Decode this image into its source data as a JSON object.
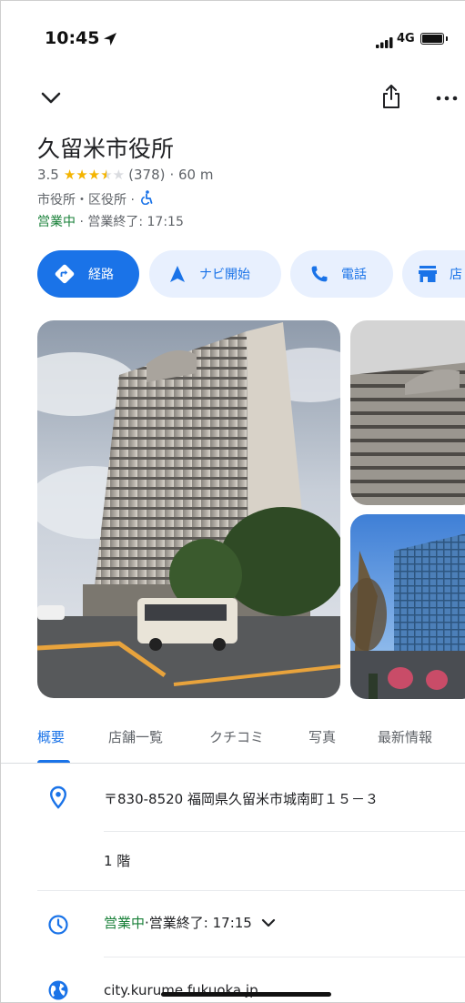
{
  "status_bar": {
    "time": "10:45",
    "network": "4G"
  },
  "place": {
    "name": "久留米市役所",
    "rating": "3.5",
    "rating_value": 3.5,
    "review_count": "(378)",
    "distance": "· 60 m",
    "category": "市役所・区役所 ·",
    "open_status": "営業中",
    "hours_sep": " · ",
    "hours_text": "営業終了: 17:15"
  },
  "actions": [
    {
      "label": "経路",
      "icon": "directions-icon"
    },
    {
      "label": "ナビ開始",
      "icon": "navigation-icon"
    },
    {
      "label": "電話",
      "icon": "phone-icon"
    },
    {
      "label": "店",
      "icon": "store-icon"
    }
  ],
  "tabs": [
    "概要",
    "店舗一覧",
    "クチコミ",
    "写真",
    "最新情報"
  ],
  "details": {
    "address": "〒830-8520 福岡県久留米市城南町１５－３",
    "floor": "1 階",
    "hours_status": "営業中",
    "hours_sep": " · ",
    "hours_text": "営業終了: 17:15",
    "website": "city.kurume.fukuoka.jp"
  },
  "colors": {
    "accent": "#1a73e8",
    "chip_bg": "#e8f0fe",
    "open_green": "#188038",
    "star": "#f4b400"
  }
}
